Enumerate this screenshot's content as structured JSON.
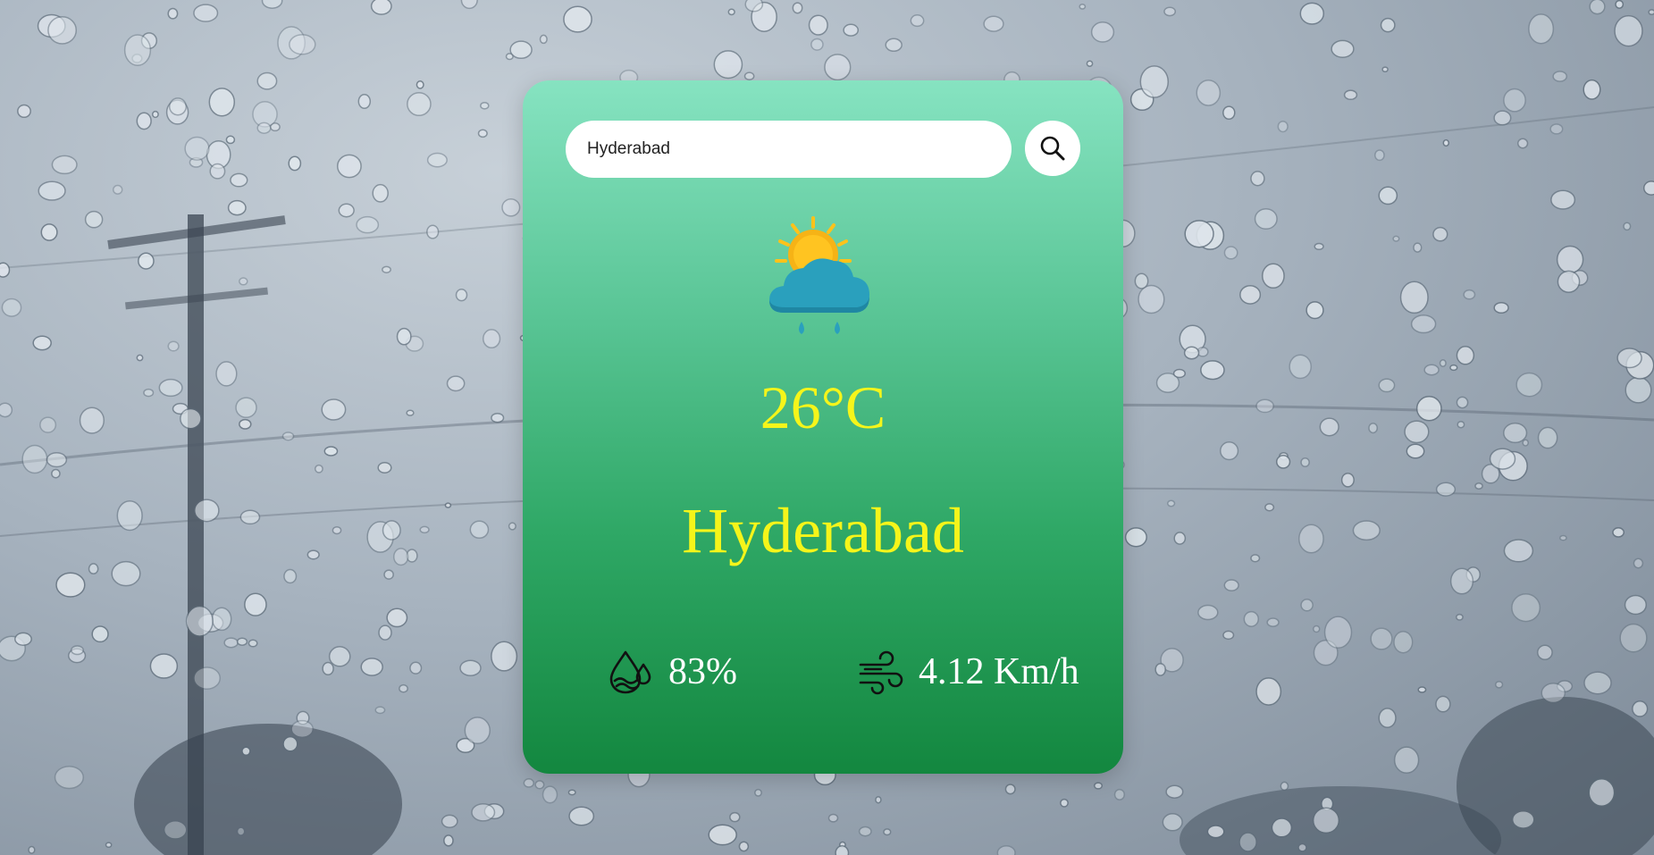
{
  "search": {
    "value": "Hyderabad",
    "placeholder": ""
  },
  "weather": {
    "icon": "sun-behind-rain-cloud-icon",
    "temperature": "26°C",
    "city": "Hyderabad",
    "humidity": "83%",
    "wind_speed": "4.12 Km/h"
  },
  "colors": {
    "card_top": "#86e3c1",
    "card_bottom": "#13873f",
    "accent_text": "#f5f51a",
    "detail_text": "#ffffff"
  }
}
